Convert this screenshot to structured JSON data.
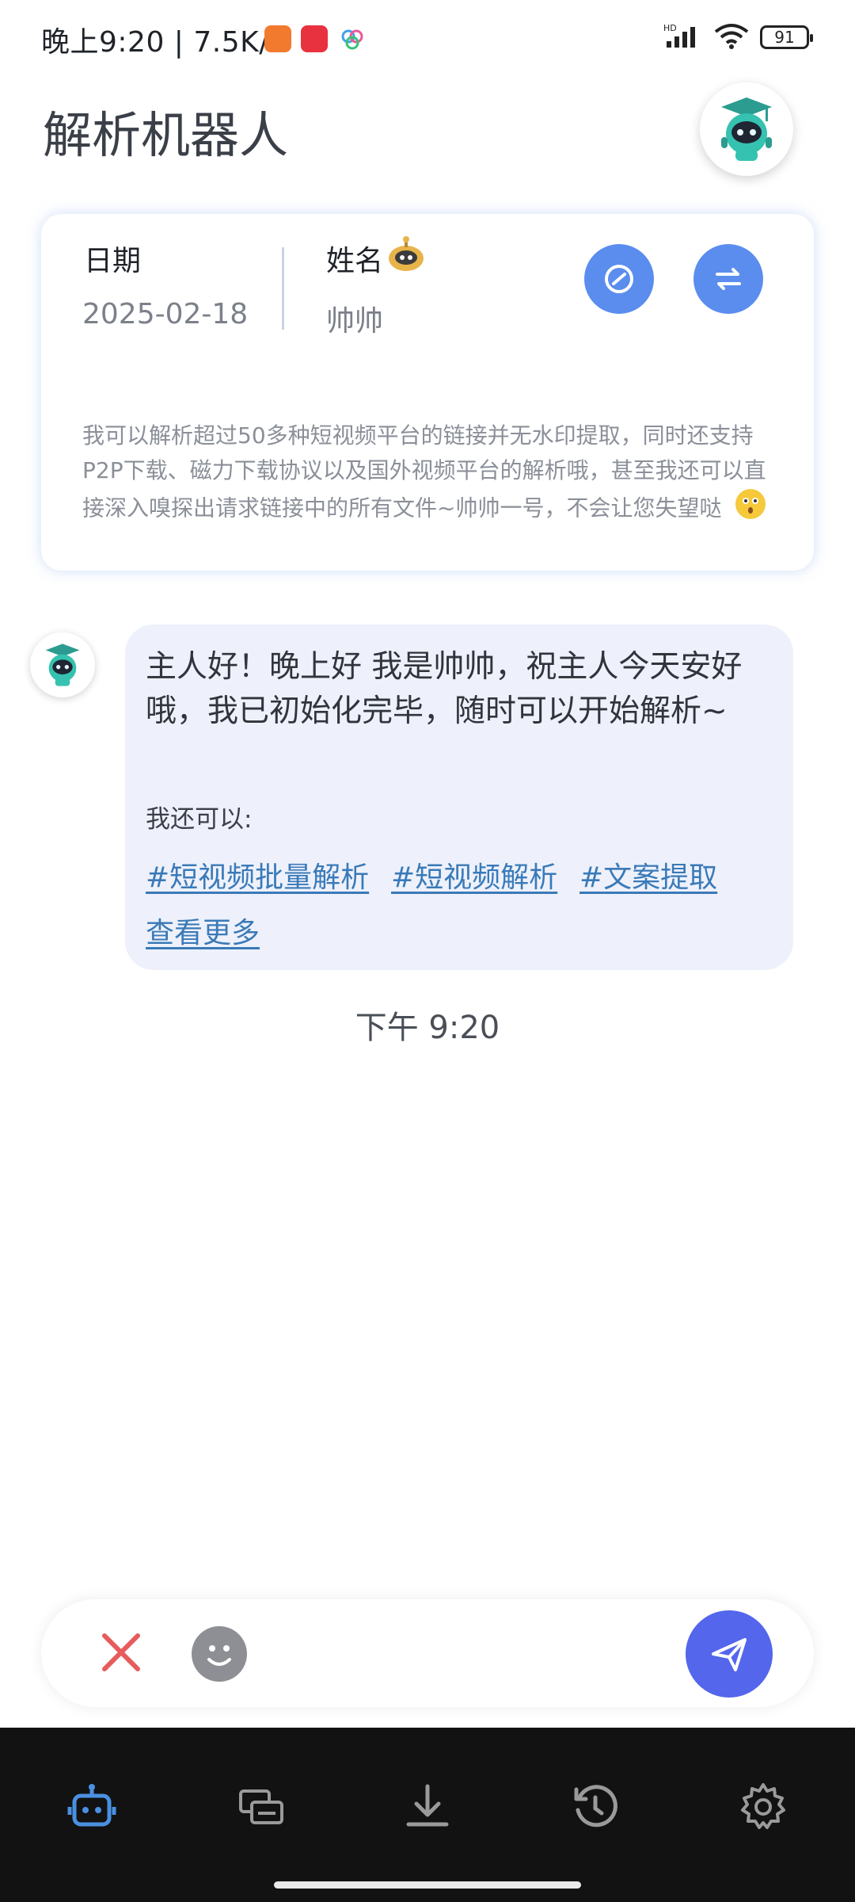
{
  "status_bar": {
    "time_speed": "晚上9:20 | 7.5K/s",
    "network_label": "HD",
    "battery": "91",
    "app_icons": [
      "taobao-icon",
      "xiaohongshu-icon",
      "cloud-app-icon"
    ]
  },
  "header": {
    "title": "解析机器人"
  },
  "info_card": {
    "date_label": "日期",
    "date_value": "2025-02-18",
    "name_label": "姓名",
    "name_value": "帅帅",
    "description": "我可以解析超过50多种短视频平台的链接并无水印提取，同时还支持P2P下载、磁力下载协议以及国外视频平台的解析哦，甚至我还可以直接深入嗅探出请求链接中的所有文件~帅帅一号，不会让您失望哒"
  },
  "chat": {
    "greeting": "主人好！晚上好 我是帅帅，祝主人今天安好哦，我已初始化完毕，随时可以开始解析~",
    "also_can": "我还可以:",
    "tags": [
      "#短视频批量解析",
      "#短视频解析",
      "#文案提取"
    ],
    "more": "查看更多",
    "time": "下午 9:20"
  },
  "bottom_nav": {
    "items": [
      "robot-icon",
      "cards-icon",
      "download-icon",
      "history-icon",
      "settings-icon"
    ],
    "active": "robot-icon"
  },
  "colors": {
    "accent": "#5b8def",
    "send": "#5366ec",
    "link": "#3a7ab8",
    "bubble": "#eef1fb",
    "nav_bg": "#121212",
    "nav_active": "#4a90e2"
  }
}
